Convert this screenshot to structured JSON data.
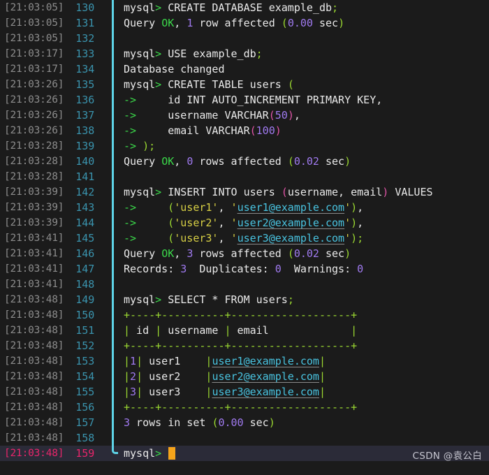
{
  "terminal": {
    "title": "mysql client session",
    "colors": {
      "background": "#1b1b1b",
      "active_line_background": "#2b2b38",
      "gutter_timestamp": "#8c8c8c",
      "gutter_line_number": "#3a93ad",
      "gutter_active": "#e8256b",
      "divider": "#5ed4e8",
      "cursor": "#f5a41b",
      "prompt_arrow": "#3bd94a",
      "table_border": "#9bd831",
      "number": "#a07af0",
      "string": "#d8d045",
      "link": "#49c3e0"
    },
    "watermark": "CSDN @袁公白",
    "prompt": "mysql>",
    "lines": [
      {
        "time": "[21:03:05]",
        "num": "130",
        "text": "mysql> CREATE DATABASE example_db;"
      },
      {
        "time": "[21:03:05]",
        "num": "131",
        "text": "Query OK, 1 row affected (0.00 sec)"
      },
      {
        "time": "[21:03:05]",
        "num": "132",
        "text": ""
      },
      {
        "time": "[21:03:17]",
        "num": "133",
        "text": "mysql> USE example_db;"
      },
      {
        "time": "[21:03:17]",
        "num": "134",
        "text": "Database changed"
      },
      {
        "time": "[21:03:26]",
        "num": "135",
        "text": "mysql> CREATE TABLE users ("
      },
      {
        "time": "[21:03:26]",
        "num": "136",
        "text": "    ->     id INT AUTO_INCREMENT PRIMARY KEY,"
      },
      {
        "time": "[21:03:26]",
        "num": "137",
        "text": "    ->     username VARCHAR(50),"
      },
      {
        "time": "[21:03:26]",
        "num": "138",
        "text": "    ->     email VARCHAR(100)"
      },
      {
        "time": "[21:03:28]",
        "num": "139",
        "text": "    -> );"
      },
      {
        "time": "[21:03:28]",
        "num": "140",
        "text": "Query OK, 0 rows affected (0.02 sec)"
      },
      {
        "time": "[21:03:28]",
        "num": "141",
        "text": ""
      },
      {
        "time": "[21:03:39]",
        "num": "142",
        "text": "mysql> INSERT INTO users (username, email) VALUES"
      },
      {
        "time": "[21:03:39]",
        "num": "143",
        "text": "    ->     ('user1', 'user1@example.com'),"
      },
      {
        "time": "[21:03:39]",
        "num": "144",
        "text": "    ->     ('user2', 'user2@example.com'),"
      },
      {
        "time": "[21:03:41]",
        "num": "145",
        "text": "    ->     ('user3', 'user3@example.com');"
      },
      {
        "time": "[21:03:41]",
        "num": "146",
        "text": "Query OK, 3 rows affected (0.02 sec)"
      },
      {
        "time": "[21:03:41]",
        "num": "147",
        "text": "Records: 3  Duplicates: 0  Warnings: 0"
      },
      {
        "time": "[21:03:41]",
        "num": "148",
        "text": ""
      },
      {
        "time": "[21:03:48]",
        "num": "149",
        "text": "mysql> SELECT * FROM users;"
      },
      {
        "time": "[21:03:48]",
        "num": "150",
        "text": "+----+----------+-------------------+"
      },
      {
        "time": "[21:03:48]",
        "num": "151",
        "text": "| id | username | email             |"
      },
      {
        "time": "[21:03:48]",
        "num": "152",
        "text": "+----+----------+-------------------+"
      },
      {
        "time": "[21:03:48]",
        "num": "153",
        "text": "|  1 | user1    | user1@example.com |"
      },
      {
        "time": "[21:03:48]",
        "num": "154",
        "text": "|  2 | user2    | user2@example.com |"
      },
      {
        "time": "[21:03:48]",
        "num": "155",
        "text": "|  3 | user3    | user3@example.com |"
      },
      {
        "time": "[21:03:48]",
        "num": "156",
        "text": "+----+----------+-------------------+"
      },
      {
        "time": "[21:03:48]",
        "num": "157",
        "text": "3 rows in set (0.00 sec)"
      },
      {
        "time": "[21:03:48]",
        "num": "158",
        "text": ""
      },
      {
        "time": "[21:03:48]",
        "num": "159",
        "text": "mysql> ",
        "active": true,
        "cursor": true
      }
    ],
    "result_table": {
      "columns": [
        "id",
        "username",
        "email"
      ],
      "rows": [
        [
          "1",
          "user1",
          "user1@example.com"
        ],
        [
          "2",
          "user2",
          "user2@example.com"
        ],
        [
          "3",
          "user3",
          "user3@example.com"
        ]
      ],
      "footer": "3 rows in set (0.00 sec)"
    }
  }
}
